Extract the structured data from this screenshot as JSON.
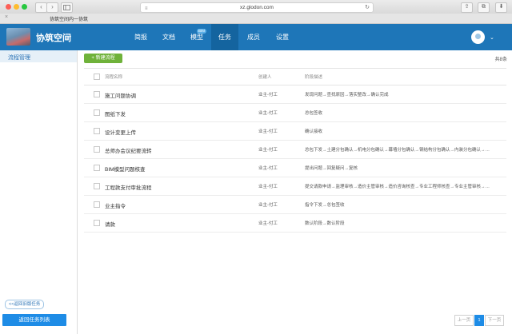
{
  "browser": {
    "url": "xz.glodon.com",
    "tab_title": "协筑空间内一协筑",
    "tab_close": "×",
    "back_glyph": "‹",
    "forward_glyph": "›",
    "share_glyph": "⇪",
    "tabs_glyph": "⧉",
    "download_glyph": "⬇"
  },
  "header": {
    "project_name": "协筑空间",
    "project_caret": "⌄",
    "nav": [
      {
        "label": "简报"
      },
      {
        "label": "文档"
      },
      {
        "label": "模型",
        "badge": "BIM"
      },
      {
        "label": "任务"
      },
      {
        "label": "成员"
      },
      {
        "label": "设置"
      }
    ],
    "active_nav": "任务",
    "avatar_caret": "⌄"
  },
  "sidebar": {
    "items": [
      {
        "label": "流程管理"
      }
    ],
    "back_link": "<<返回旧版任务",
    "back_button": "返回任务列表"
  },
  "main": {
    "new_button": "+ 新建流程",
    "total": "共8条",
    "columns": {
      "name": "流程名称",
      "creator": "创建人",
      "desc": "阶段描述"
    },
    "rows": [
      {
        "name": "施工问题协调",
        "creator": "业主-付工",
        "desc": "发现问题→查找原因→落实整改→确认完成"
      },
      {
        "name": "图纸下发",
        "creator": "业主-付工",
        "desc": "总包签收"
      },
      {
        "name": "设计变更上传",
        "creator": "业主-付工",
        "desc": "确认接收"
      },
      {
        "name": "总师办会议纪要流转",
        "creator": "业主-付工",
        "desc": "总包下发→土建分包确认→机电分包确认→幕墙分包确认→钢结构分包确认→内装分包确认→…"
      },
      {
        "name": "BIM模型问题核查",
        "creator": "业主-付工",
        "desc": "提出问题→回复疑问→复核"
      },
      {
        "name": "工程款支付审批流程",
        "creator": "业主-付工",
        "desc": "提交请款申请→监理审核→造价主管审核→造价咨询核查→专业工程师核查→专业主管审核→…"
      },
      {
        "name": "业主指令",
        "creator": "业主-付工",
        "desc": "指令下发→总包签收"
      },
      {
        "name": "请款",
        "creator": "业主-付工",
        "desc": "数认阶段→数认阶段"
      }
    ],
    "pager": {
      "prev": "上一页",
      "current": "1",
      "next": "下一页"
    }
  }
}
